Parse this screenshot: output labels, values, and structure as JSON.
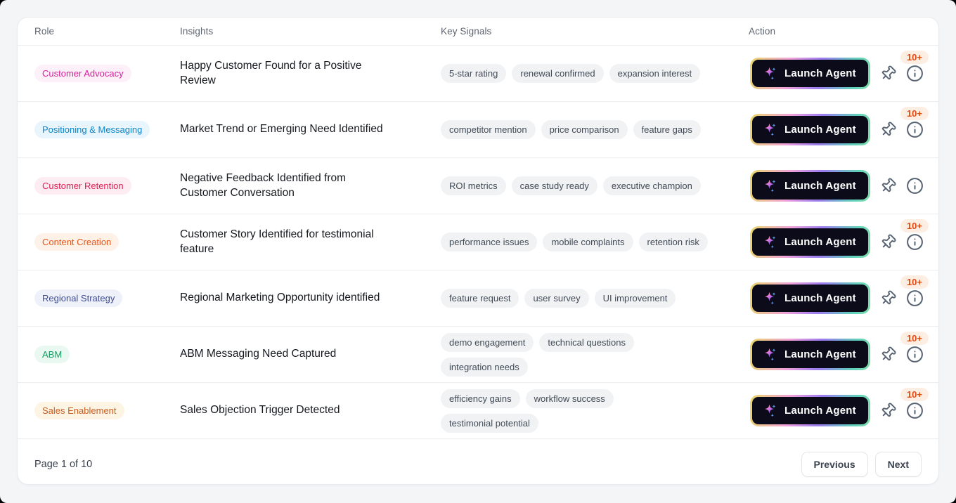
{
  "table": {
    "columns": [
      "Role",
      "Insights",
      "Key Signals",
      "Action"
    ],
    "launch_button_label": "Launch Agent",
    "rows": [
      {
        "role": "Customer Advocacy",
        "role_color": "#d6219c",
        "role_bg": "#fdf0f8",
        "insight": "Happy Customer Found for a Positive Review",
        "signals": [
          "5-star rating",
          "renewal confirmed",
          "expansion interest"
        ],
        "badge": "10+"
      },
      {
        "role": "Positioning & Messaging",
        "role_color": "#0b85c6",
        "role_bg": "#e9f5fd",
        "insight": "Market Trend or Emerging Need Identified",
        "signals": [
          "competitor mention",
          "price comparison",
          "feature gaps"
        ],
        "badge": "10+"
      },
      {
        "role": "Customer Retention",
        "role_color": "#dc2056",
        "role_bg": "#fdedf2",
        "insight": "Negative Feedback Identified from Customer Conversation",
        "signals": [
          "ROI metrics",
          "case study ready",
          "executive champion"
        ],
        "badge": null
      },
      {
        "role": "Content Creation",
        "role_color": "#e4571c",
        "role_bg": "#fdf1e8",
        "insight": "Customer Story Identified for testimonial feature",
        "signals": [
          "performance issues",
          "mobile complaints",
          "retention risk"
        ],
        "badge": "10+"
      },
      {
        "role": "Regional Strategy",
        "role_color": "#3f4d91",
        "role_bg": "#eef1fa",
        "insight": "Regional Marketing Opportunity identified",
        "signals": [
          "feature request",
          "user survey",
          "UI improvement"
        ],
        "badge": "10+"
      },
      {
        "role": "ABM",
        "role_color": "#149d60",
        "role_bg": "#e9f8f0",
        "insight": "ABM Messaging Need Captured",
        "signals": [
          "demo engagement",
          "technical questions",
          "integration needs"
        ],
        "badge": "10+"
      },
      {
        "role": "Sales Enablement",
        "role_color": "#c95c1f",
        "role_bg": "#fdf4e3",
        "insight": "Sales Objection Trigger Detected",
        "signals": [
          "efficiency gains",
          "workflow success",
          "testimonial potential"
        ],
        "badge": "10+"
      }
    ]
  },
  "footer": {
    "page_status": "Page 1 of 10",
    "previous_label": "Previous",
    "next_label": "Next"
  },
  "colors": {
    "accent_badge_bg": "#fdeee4",
    "accent_badge_text": "#e24a0f",
    "button_bg": "#0b0b1a",
    "gradient_border": [
      "#ead76a",
      "#f2a2d8",
      "#9b7cf2",
      "#5fd0bd"
    ]
  }
}
